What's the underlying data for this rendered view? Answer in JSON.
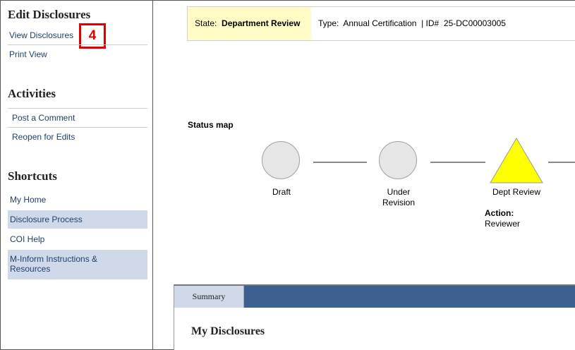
{
  "sidebar": {
    "edit_title": "Edit Disclosures",
    "edit_items": [
      "View Disclosures",
      "Print View"
    ],
    "callout_number": "4",
    "activities_title": "Activities",
    "activity_items": [
      "Post a Comment",
      "Reopen for Edits"
    ],
    "shortcuts_title": "Shortcuts",
    "shortcut_items": [
      "My Home",
      "Disclosure Process",
      "COI Help",
      "M-Inform Instructions & Resources"
    ]
  },
  "state_bar": {
    "state_label": "State:",
    "state_value": "Department Review",
    "type_label": "Type:",
    "type_value": "Annual Certification",
    "id_label": "| ID#",
    "id_value": "25-DC00003005"
  },
  "status_map": {
    "title": "Status map",
    "nodes": [
      {
        "label": "Draft",
        "shape": "circle",
        "color": "#e6e6e6"
      },
      {
        "label": "Under Revision",
        "shape": "circle",
        "color": "#e6e6e6"
      },
      {
        "label": "Dept Review",
        "shape": "triangle",
        "color": "#ffff00"
      }
    ],
    "action_label": "Action:",
    "action_value": "Reviewer"
  },
  "tabs": {
    "items": [
      "Summary"
    ],
    "accent": "#3e6090"
  },
  "main": {
    "heading": "My Disclosures"
  }
}
